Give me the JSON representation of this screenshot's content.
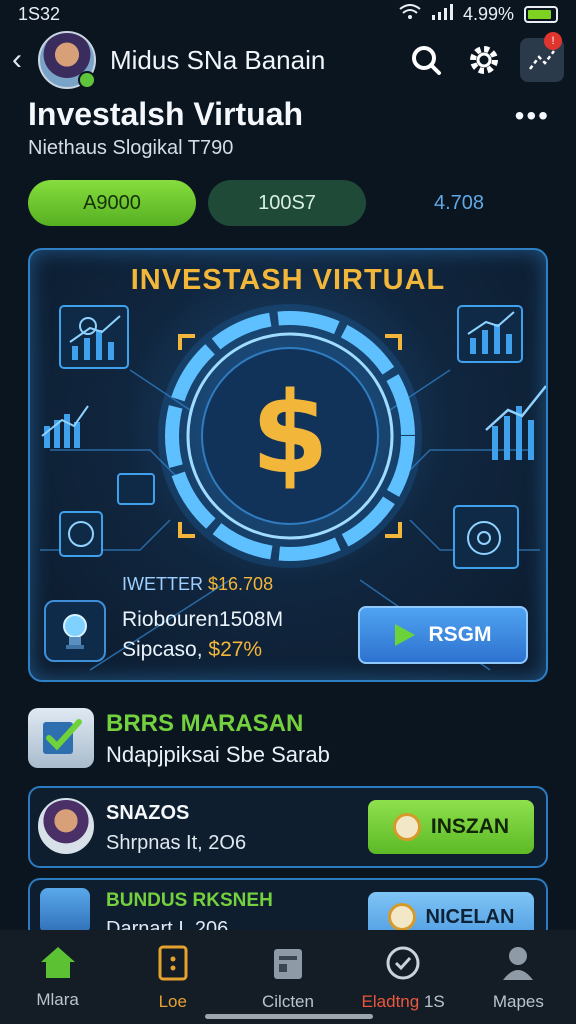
{
  "status_bar": {
    "time": "1S32",
    "battery": "4.99%",
    "battery_level": 0.9
  },
  "header": {
    "title": "Midus SNa Banain"
  },
  "page": {
    "title": "Investalsh Virtuah",
    "subtitle": "Niethaus Slogikal T790"
  },
  "pills": [
    {
      "label": "A9000"
    },
    {
      "label": "100S7"
    },
    {
      "label": "4.708"
    }
  ],
  "hero": {
    "title": "INVESTASH VIRTUAL",
    "line1_prefix": "IWETTER",
    "line1_amount": "$16.708",
    "line2": "Riobouren1508M",
    "line3_prefix": "Sipcaso,",
    "line3_amount": "$27%",
    "button": "RSGM"
  },
  "section": {
    "title": "BRRS MARASAN",
    "subtitle": "Ndapjpiksai Sbe Sarab"
  },
  "cards": [
    {
      "title": "SNAZOS",
      "subtitle": "Shrpnas It, 2O6",
      "button": "INSZAN"
    },
    {
      "title": "BUNDUS RKSNEH",
      "subtitle": "Darnart I. 206",
      "button": "NICELAN"
    }
  ],
  "bottom_nav": [
    {
      "label": "Mlara",
      "icon": "home-icon"
    },
    {
      "label": "Loe",
      "icon": "card-icon"
    },
    {
      "label": "Cilcten",
      "icon": "calendar-icon"
    },
    {
      "label": "Eladtng",
      "badge": "1S",
      "icon": "check-icon"
    },
    {
      "label": "Mapes",
      "icon": "profile-icon"
    }
  ],
  "colors": {
    "accent_green": "#74d13e",
    "accent_gold": "#f2b63a",
    "accent_blue": "#2e7fc4",
    "background": "#0b1520"
  }
}
